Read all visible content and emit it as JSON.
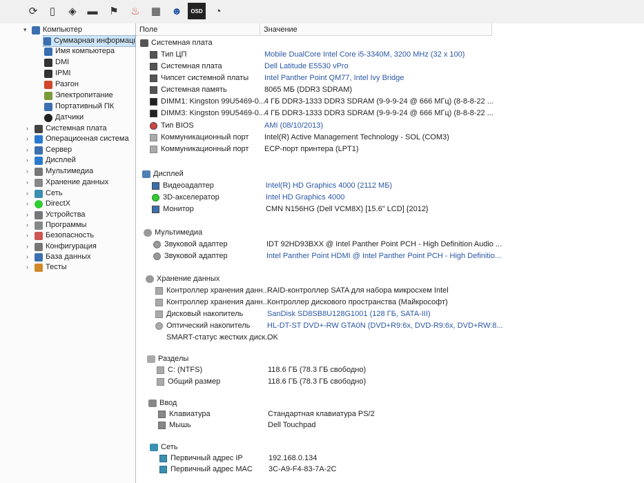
{
  "toolbar": {
    "icons": [
      "refresh-icon",
      "report-icon",
      "network-icon",
      "display-icon",
      "flag-icon",
      "flame-icon",
      "calendar-icon",
      "user-icon",
      "osd-icon",
      "speed-icon"
    ],
    "osd_label": "OSD"
  },
  "tree": {
    "root": "Компьютер",
    "children": [
      "Суммарная информация",
      "Имя компьютера",
      "DMI",
      "IPMI",
      "Разгон",
      "Электропитание",
      "Портативный ПК",
      "Датчики"
    ],
    "sections": [
      "Системная плата",
      "Операционная система",
      "Сервер",
      "Дисплей",
      "Мультимедиа",
      "Хранение данных",
      "Сеть",
      "DirectX",
      "Устройства",
      "Программы",
      "Безопасность",
      "Конфигурация",
      "База данных",
      "Тесты"
    ]
  },
  "columns": {
    "field": "Поле",
    "value": "Значение"
  },
  "groups": [
    {
      "title": "Системная плата",
      "rows": [
        {
          "field": "Тип ЦП",
          "value": "Mobile DualCore Intel Core i5-3340M, 3200 MHz (32 x 100)",
          "link": true
        },
        {
          "field": "Системная плата",
          "value": "Dell Latitude E5530 vPro",
          "link": true
        },
        {
          "field": "Чипсет системной платы",
          "value": "Intel Panther Point QM77, Intel Ivy Bridge",
          "link": true
        },
        {
          "field": "Системная память",
          "value": "8065 МБ  (DDR3 SDRAM)",
          "link": false
        },
        {
          "field": "DIMM1: Kingston 99U5469-0...",
          "value": "4 ГБ DDR3-1333 DDR3 SDRAM  (9-9-9-24 @ 666 МГц)  (8-8-8-22 ...",
          "link": false
        },
        {
          "field": "DIMM3: Kingston 99U5469-0...",
          "value": "4 ГБ DDR3-1333 DDR3 SDRAM  (9-9-9-24 @ 666 МГц)  (8-8-8-22 ...",
          "link": false
        },
        {
          "field": "Тип BIOS",
          "value": "AMI (08/10/2013)",
          "link": true
        },
        {
          "field": "Коммуникационный порт",
          "value": "Intel(R) Active Management Technology - SOL (COM3)",
          "link": false
        },
        {
          "field": "Коммуникационный порт",
          "value": "ECP-порт принтера (LPT1)",
          "link": false
        }
      ]
    },
    {
      "title": "Дисплей",
      "rows": [
        {
          "field": "Видеоадаптер",
          "value": "Intel(R) HD Graphics 4000  (2112 МБ)",
          "link": true
        },
        {
          "field": "3D-акселератор",
          "value": "Intel HD Graphics 4000",
          "link": true
        },
        {
          "field": "Монитор",
          "value": "CMN N156HG (Dell VCM8X)  [15.6\" LCD]  {2012}",
          "link": false
        }
      ]
    },
    {
      "title": "Мультимедиа",
      "rows": [
        {
          "field": "Звуковой адаптер",
          "value": "IDT 92HD93BXX @ Intel Panther Point PCH - High Definition Audio ...",
          "link": false
        },
        {
          "field": "Звуковой адаптер",
          "value": "Intel Panther Point HDMI @ Intel Panther Point PCH - High Definitio...",
          "link": true
        }
      ]
    },
    {
      "title": "Хранение данных",
      "rows": [
        {
          "field": "Контроллер хранения данн...",
          "value": "RAID-контроллер SATA для набора микросхем Intel",
          "link": false
        },
        {
          "field": "Контроллер хранения данн...",
          "value": "Контроллер дискового пространства (Майкрософт)",
          "link": false
        },
        {
          "field": "Дисковый накопитель",
          "value": "SanDisk SD8SB8U128G1001  (128 ГБ, SATA-III)",
          "link": true
        },
        {
          "field": "Оптический накопитель",
          "value": "HL-DT-ST DVD+-RW GTA0N  (DVD+R9:6x, DVD-R9:6x, DVD+RW:8...",
          "link": true
        },
        {
          "field": "SMART-статус жестких диск...",
          "value": "OK",
          "link": false
        }
      ]
    },
    {
      "title": "Разделы",
      "rows": [
        {
          "field": "C: (NTFS)",
          "value": "118.6 ГБ (78.3 ГБ свободно)",
          "link": false
        },
        {
          "field": "Общий размер",
          "value": "118.6 ГБ (78.3 ГБ свободно)",
          "link": false
        }
      ]
    },
    {
      "title": "Ввод",
      "rows": [
        {
          "field": "Клавиатура",
          "value": "Стандартная клавиатура PS/2",
          "link": false
        },
        {
          "field": "Мышь",
          "value": "Dell Touchpad",
          "link": false
        }
      ]
    },
    {
      "title": "Сеть",
      "rows": [
        {
          "field": "Первичный адрес IP",
          "value": "192.168.0.134",
          "link": false
        },
        {
          "field": "Первичный адрес MAC",
          "value": "3C-A9-F4-83-7A-2C",
          "link": false
        }
      ]
    }
  ]
}
